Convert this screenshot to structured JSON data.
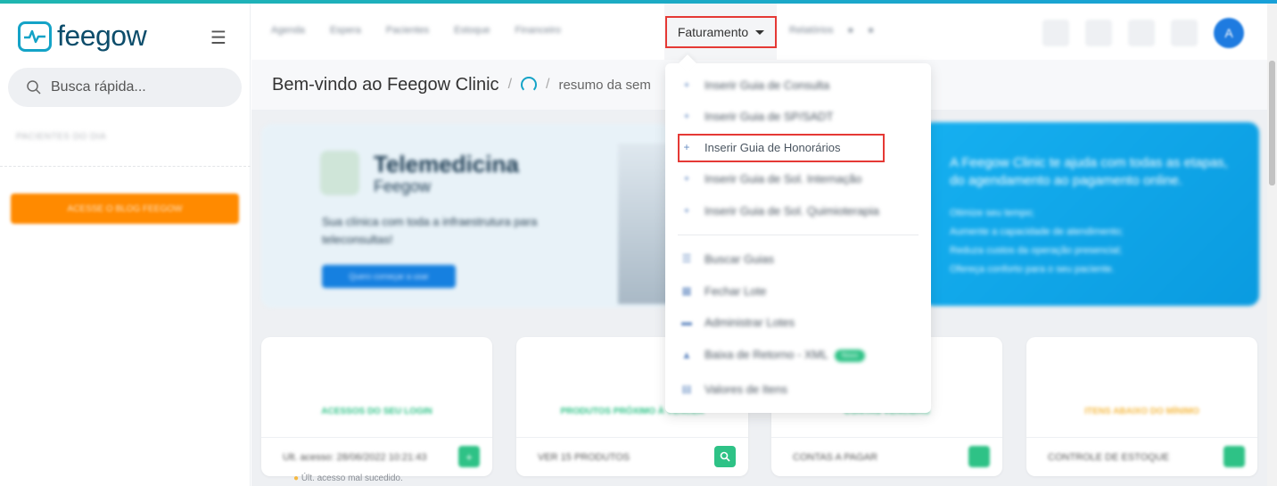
{
  "app": {
    "brand": "feegow",
    "accent_color": "#14a3c7"
  },
  "sidebar": {
    "search_placeholder": "Busca rápida...",
    "section_label": "PACIENTES DO DIA",
    "blog_button": "ACESSE O BLOG FEEGOW"
  },
  "topnav": {
    "items": [
      "Agenda",
      "Espera",
      "Pacientes",
      "Estoque",
      "Financeiro"
    ],
    "active": "Faturamento",
    "after": "Relatórios",
    "avatar_initial": "A"
  },
  "breadcrumb": {
    "title": "Bem-vindo ao Feegow Clinic",
    "separator": "/",
    "current": "resumo da sem"
  },
  "banner_left": {
    "title": "Telemedicina",
    "subtitle": "Feegow",
    "text": "Sua clínica com toda a infraestrutura para teleconsultas!",
    "button": "Quero começar a usar"
  },
  "banner_right": {
    "headline": "A Feegow Clinic te ajuda com todas as etapas, do agendamento ao pagamento online.",
    "lines": [
      "Otimize seu tempo;",
      "Aumente a capacidade de atendimento;",
      "Reduza custos da operação presencial;",
      "Ofereça conforto para o seu paciente."
    ]
  },
  "cards": [
    {
      "title": "ACESSOS DO SEU LOGIN",
      "title_color": "#2ec286",
      "footer": "Ult. acesso: 28/06/2022 10:21:43",
      "warning": "Últ. acesso mal sucedido.",
      "action_icon": "plus-icon"
    },
    {
      "title": "PRODUTOS PRÓXIMO À VENCER",
      "title_color": "#2ec286",
      "footer": "VER 15 PRODUTOS",
      "action_icon": "search-icon"
    },
    {
      "title": "CONTAS VENCIDAS",
      "title_color": "#2ec286",
      "footer": "CONTAS A PAGAR",
      "action_icon": "search-icon"
    },
    {
      "title": "ITENS ABAIXO DO MÍNIMO",
      "title_color": "#f5b942",
      "footer": "CONTROLE DE ESTOQUE",
      "action_icon": "search-icon"
    }
  ],
  "dropdown": {
    "items": [
      {
        "label": "Inserir Guia de Consulta",
        "icon": "plus-icon"
      },
      {
        "label": "Inserir Guia de SP/SADT",
        "icon": "plus-icon"
      },
      {
        "label": "Inserir Guia de Honorários",
        "icon": "plus-icon"
      },
      {
        "label": "Inserir Guia de Sol. Internação",
        "icon": "plus-icon"
      },
      {
        "label": "Inserir Guia de Sol. Quimioterapia",
        "icon": "plus-icon"
      },
      {
        "label": "Buscar Guias",
        "icon": "list-icon"
      },
      {
        "label": "Fechar Lote",
        "icon": "calendar-icon"
      },
      {
        "label": "Administrar Lotes",
        "icon": "folder-icon"
      },
      {
        "label": "Baixa de Retorno - XML",
        "icon": "upload-icon",
        "badge": "Novo"
      },
      {
        "label": "Valores de Itens",
        "icon": "table-icon"
      }
    ]
  }
}
